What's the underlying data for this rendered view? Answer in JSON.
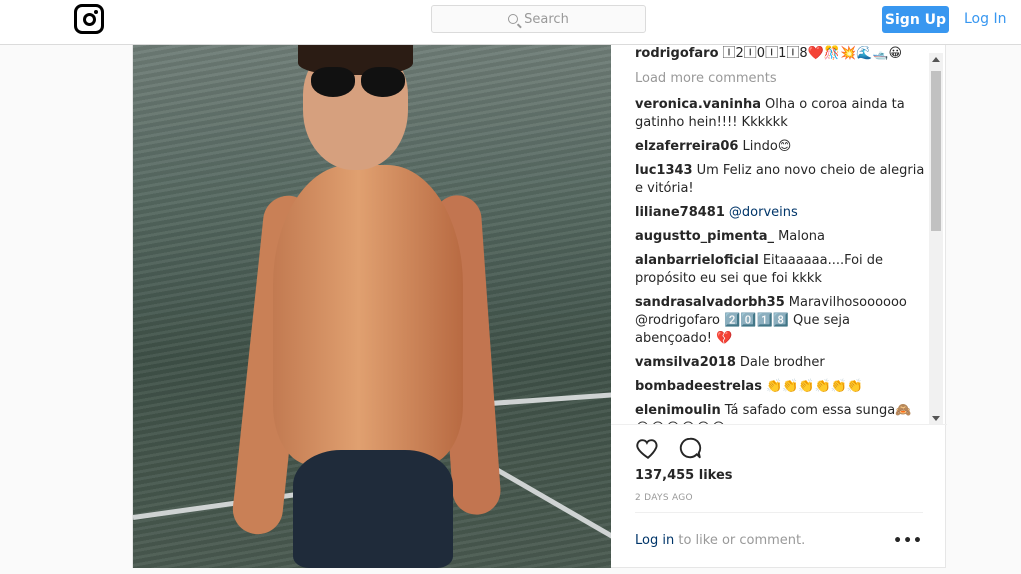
{
  "header": {
    "search_placeholder": "Search",
    "signup_label": "Sign Up",
    "login_label": "Log In"
  },
  "post": {
    "top_comment": {
      "user": "rodrigofaro",
      "text": "🄸2🄸0🄸1🄸8❤️🎊💥🌊🛥️😀"
    },
    "load_more": "Load more comments",
    "comments": [
      {
        "user": "veronica.vaninha",
        "text": "Olha o coroa ainda ta gatinho hein!!!! Kkkkkk"
      },
      {
        "user": "elzaferreira06",
        "text": "Lindo😊"
      },
      {
        "user": "luc1343",
        "text": "Um Feliz ano novo cheio de alegria e vitória!"
      },
      {
        "user": "liliane78481",
        "text": "@dorveins"
      },
      {
        "user": "augustto_pimenta_",
        "text": "Malona"
      },
      {
        "user": "alanbarrieloficial",
        "text": "Eitaaaaaa....Foi de propósito eu sei que foi kkkk"
      },
      {
        "user": "sandrasalvadorbh35",
        "text": "Maravilhosoooooo @rodrigofaro 2️⃣0️⃣1️⃣8️⃣ Que seja abençoado! 💔"
      },
      {
        "user": "vamsilva2018",
        "text": "Dale brodher"
      },
      {
        "user": "bombadeestrelas",
        "text": "👏👏👏👏👏👏"
      },
      {
        "user": "elenimoulin",
        "text": "Tá safado com essa sunga🙈 😂😂😂😂😂😂"
      }
    ],
    "likes": "137,455 likes",
    "date": "2 DAYS AGO",
    "login_link": "Log in",
    "login_suffix": "to like or comment.",
    "more_label": "•••"
  }
}
